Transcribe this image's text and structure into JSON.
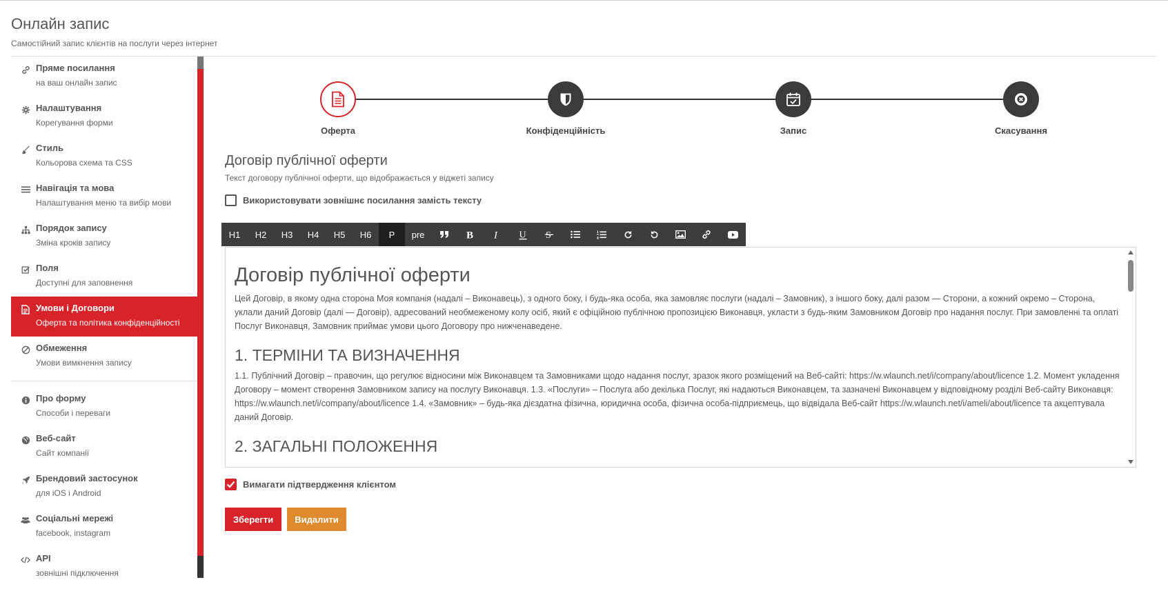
{
  "header": {
    "title": "Онлайн запис",
    "subtitle": "Самостійний запис клієнтів на послуги через інтернет"
  },
  "colors": {
    "accent": "#d8232a",
    "delete": "#e08a2e",
    "dark": "#3b3b3b"
  },
  "sidebar": {
    "items": [
      {
        "icon": "link-icon",
        "title": "Пряме посилання",
        "sub": "на ваш онлайн запис"
      },
      {
        "icon": "gear-icon",
        "title": "Налаштування",
        "sub": "Корегування форми"
      },
      {
        "icon": "brush-icon",
        "title": "Стиль",
        "sub": "Кольорова схема та CSS"
      },
      {
        "icon": "menu-icon",
        "title": "Навігація та мова",
        "sub": "Налаштування меню та вибір мови"
      },
      {
        "icon": "sitemap-icon",
        "title": "Порядок запису",
        "sub": "Зміна кроків запису"
      },
      {
        "icon": "checkbox-icon",
        "title": "Поля",
        "sub": "Доступні для заповнення"
      },
      {
        "icon": "document-icon",
        "title": "Умови і Договори",
        "sub": "Оферта та політика конфіденційності",
        "active": true
      },
      {
        "icon": "ban-icon",
        "title": "Обмеження",
        "sub": "Умови вимкнення запису"
      }
    ],
    "items2": [
      {
        "icon": "info-icon",
        "title": "Про форму",
        "sub": "Способи і переваги"
      },
      {
        "icon": "globe-icon",
        "title": "Веб-сайт",
        "sub": "Сайт компанії"
      },
      {
        "icon": "rocket-icon",
        "title": "Брендовий застосунок",
        "sub": "для iOS і Android"
      },
      {
        "icon": "users-icon",
        "title": "Соціальні мережі",
        "sub": "facebook, instagram"
      },
      {
        "icon": "code-icon",
        "title": "API",
        "sub": "зовнішні підключення"
      }
    ]
  },
  "stepper": {
    "steps": [
      {
        "label": "Оферта",
        "icon": "document-icon",
        "active": true
      },
      {
        "label": "Конфіденційність",
        "icon": "shield-icon"
      },
      {
        "label": "Запис",
        "icon": "calendar-check-icon"
      },
      {
        "label": "Скасування",
        "icon": "cancel-circle-icon"
      }
    ]
  },
  "section": {
    "title": "Договір публічної оферти",
    "subtitle": "Текст договору публічної оферти, що відображається у віджеті запису",
    "external_link_label": "Використовувати зовнішнє посилання замість тексту",
    "external_link_checked": false
  },
  "toolbar": {
    "buttons": [
      "H1",
      "H2",
      "H3",
      "H4",
      "H5",
      "H6",
      "P",
      "pre"
    ],
    "active": "P"
  },
  "editor": {
    "h1": "Договір публічної оферти",
    "p1": "Цей Договір, в якому одна сторона Моя компанія (надалі – Виконавець), з одного боку, і будь-яка особа, яка замовляє послуги (надалі – Замовник), з іншого боку, далі разом — Сторони, а кожний окремо – Сторона, уклали даний Договір (далі — Договір), адресований необмеженому колу осіб, який є офіційною публічною пропозицією Виконавця, укласти з будь-яким Замовником Договір про надання послуг. При замовленні та оплаті Послуг Виконавця, Замовник приймає умови цього Договору про нижченаведене.",
    "h2_1": "1. ТЕРМІНИ ТА ВИЗНАЧЕННЯ",
    "p2": "1.1. Публічний Договір – правочин, що регулює відносини між Виконавцем та Замовниками щодо надання послуг, зразок якого розміщений на Веб-сайті: https://w.wlaunch.net/i/company/about/licence 1.2. Момент укладення Договору – момент створення Замовником запису на послугу Виконавця. 1.3. «Послуги» – Послуга або декілька Послуг, які надаються Виконавцем, та зазначені Виконавцем у відповідному розділі Веб-сайту Виконавця: https://w.wlaunch.net/i/company/about/licence 1.4. «Замовник» – будь-яка дієздатна фізична, юридична особа, фізична особа-підприємець, що відвідала Веб-сайт https://w.wlaunch.net/i/ameli/about/licence та акцептувала даний Договір.",
    "h2_2": "2. ЗАГАЛЬНІ ПОЛОЖЕННЯ"
  },
  "confirm": {
    "label": "Вимагати підтвердження клієнтом",
    "checked": true
  },
  "actions": {
    "save": "Зберегти",
    "delete": "Видалити"
  }
}
